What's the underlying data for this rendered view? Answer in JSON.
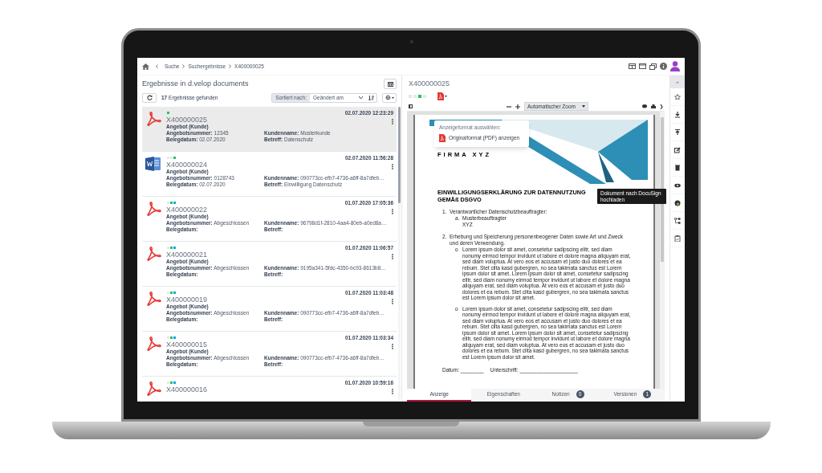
{
  "breadcrumbs": [
    "Suche",
    "Suchergebnisse",
    "X400000025"
  ],
  "results": {
    "title": "Ergebnisse in d.velop documents",
    "count": "17",
    "count_label": "Ergebnisse gefunden",
    "sort_label": "Sortiert nach:",
    "sort_value": "Geändert am",
    "items": [
      {
        "kind": "pdf",
        "selected": true,
        "dots": [
          {
            "color": "#22c55e"
          }
        ],
        "id": "X400000025",
        "date": "02.07.2020 12:23:29",
        "type": "Angebot (Kunde)",
        "fields": [
          {
            "label": "Angebotsnummer:",
            "value": "12345"
          },
          {
            "label": "Kundenname:",
            "value": "Musterkunde"
          },
          {
            "label": "Belegdatum:",
            "value": "02.07.2020"
          },
          {
            "label": "Betreff:",
            "value": "Datenschutz"
          }
        ]
      },
      {
        "kind": "word",
        "selected": false,
        "dots": [
          {
            "color": "#e5e7eb"
          },
          {
            "color": "#e5e7eb"
          },
          {
            "color": "#22c55e"
          }
        ],
        "id": "X400000024",
        "date": "02.07.2020 11:56:28",
        "type": "Angebot (Kunde)",
        "fields": [
          {
            "label": "Angebotsnummer:",
            "value": "0128743"
          },
          {
            "label": "Kundenname:",
            "value": "090773cc-efb7-4736-a6ff-8a7dfeb…"
          },
          {
            "label": "Belegdatum:",
            "value": "02.07.2020"
          },
          {
            "label": "Betreff:",
            "value": "Einwilligung Datenschutz"
          }
        ]
      },
      {
        "kind": "pdf",
        "selected": false,
        "dots": [
          {
            "color": "#e5e7eb"
          },
          {
            "color": "#22c55e"
          },
          {
            "color": "#0ea5e9"
          }
        ],
        "id": "X400000022",
        "date": "01.07.2020 17:05:36",
        "type": "Angebot (Kunde)",
        "fields": [
          {
            "label": "Angebotsnummer:",
            "value": "Abgeschlossen"
          },
          {
            "label": "Kundenname:",
            "value": "96798d1f-2810-4aa4-80eb-a0ed8a…"
          },
          {
            "label": "Belegdatum:"
          },
          {
            "label": "Betreff:"
          }
        ]
      },
      {
        "kind": "pdf",
        "selected": false,
        "dots": [
          {
            "color": "#e5e7eb"
          },
          {
            "color": "#22c55e"
          },
          {
            "color": "#0ea5e9"
          }
        ],
        "id": "X400000021",
        "date": "01.07.2020 11:06:57",
        "type": "Angebot (Kunde)",
        "fields": [
          {
            "label": "Angebotsnummer:",
            "value": "Abgeschlossen"
          },
          {
            "label": "Kundenname:",
            "value": "9195a341-5fdc-4350-bc93-8613b8…"
          },
          {
            "label": "Belegdatum:"
          },
          {
            "label": "Betreff:"
          }
        ]
      },
      {
        "kind": "pdf",
        "selected": false,
        "dots": [
          {
            "color": "#e5e7eb"
          },
          {
            "color": "#22c55e"
          },
          {
            "color": "#0ea5e9"
          }
        ],
        "id": "X400000019",
        "date": "01.07.2020 11:03:48",
        "type": "Angebot (Kunde)",
        "fields": [
          {
            "label": "Angebotsnummer:",
            "value": "Abgeschlossen"
          },
          {
            "label": "Kundenname:",
            "value": "090773cc-efb7-4736-a6ff-8a7dfeb…"
          },
          {
            "label": "Belegdatum:"
          },
          {
            "label": "Betreff:"
          }
        ]
      },
      {
        "kind": "pdf",
        "selected": false,
        "dots": [
          {
            "color": "#e5e7eb"
          },
          {
            "color": "#22c55e"
          },
          {
            "color": "#0ea5e9"
          }
        ],
        "id": "X400000015",
        "date": "01.07.2020 11:03:34",
        "type": "Angebot (Kunde)",
        "fields": [
          {
            "label": "Angebotsnummer:",
            "value": "Abgeschlossen"
          },
          {
            "label": "Kundenname:",
            "value": "090773cc-efb7-4736-a6ff-8a7dfeb…"
          },
          {
            "label": "Belegdatum:"
          },
          {
            "label": "Betreff:"
          }
        ]
      },
      {
        "kind": "pdf",
        "selected": false,
        "dots": [
          {
            "color": "#e5e7eb"
          },
          {
            "color": "#22c55e"
          },
          {
            "color": "#0ea5e9"
          }
        ],
        "id": "X400000016",
        "date": "01.07.2020 10:59:16"
      }
    ]
  },
  "viewer": {
    "title": "X400000025",
    "status": [
      {
        "color": "#e5e7eb"
      },
      {
        "color": "#e5e7eb"
      },
      {
        "color": "#22c55e"
      },
      {
        "color": "#e5e7eb"
      }
    ],
    "zoom": "Automatischer Zoom",
    "format_menu": {
      "heading": "Anzeigeformat auswählen:",
      "option": "Originalformat (PDF) anzeigen"
    },
    "tooltip": "Dokument nach DocuSign hochladen",
    "document": {
      "company": "FIRMA XYZ",
      "heading": "EINWILLIGUNGSERKLÄRUNG ZUR DATENNUTZUNG GEMÄß DSGVO",
      "sections": [
        {
          "marker": "1.",
          "text": "Verantwortlicher Datenschutzbeauftragter:",
          "children": [
            {
              "marker": "a.",
              "text": "Musterbeauftragter",
              "extra": "XYZ"
            }
          ]
        },
        {
          "marker": "2.",
          "text": "Erhebung und Speicherung personenbeogener Daten sowie Art und Zweck und deren Verwendung.",
          "children": [
            {
              "marker": "o",
              "text": "Lorem ipsum dolor sit amet, consetetur sadipscing elitr, sed diam nonumy eirmod tempor invidunt ut labore et dolore magna aliquyam erat, sed diam voluptua. At vero eos et accusam et justo duo dolores et ea rebum. Stet clita kasd gubergren, no sea takimata sanctus est Lorem ipsum dolor sit amet. Lorem ipsum dolor sit amet, consetetur sadipscing elitr, sed diam nonumy eirmod tempor invidunt ut labore et dolore magna aliquyam erat, sed diam voluptua. At vero eos et accusam et justo duo dolores et ea rebum. Stet clita kasd gubergren, no sea takimata sanctus est Lorem ipsum dolor sit amet."
            },
            {
              "marker": "o",
              "text": "Lorem ipsum dolor sit amet, consetetur sadipscing elitr, sed diam nonumy eirmod tempor invidunt ut labore et dolore magna aliquyam erat, sed diam voluptua. At vero eos et accusam et justo duo dolores et ea rebum. Stet clita kasd gubergren, no sea takimata sanctus est Lorem ipsum dolor sit amet. Lorem ipsum dolor sit amet, consetetur sadipscing elitr, sed diam nonumy eirmod tempor invidunt ut labore et dolore magna aliquyam erat, sed diam voluptua. At vero eos et accusam et justo duo dolores et ea rebum. Stet clita kasd gubergren, no sea takimata sanctus est Lorem ipsum dolor sit amet."
            }
          ]
        }
      ],
      "signature": [
        "Datum: ________",
        "Unterschrift: ____________________"
      ]
    },
    "tabs": [
      {
        "label": "Anzeige",
        "selected": true
      },
      {
        "label": "Eigenschaften",
        "selected": false
      },
      {
        "label": "Notizen",
        "selected": false,
        "badge": "0"
      },
      {
        "label": "Versionen",
        "selected": false,
        "badge": "1"
      }
    ]
  },
  "rail": [
    {
      "kind": "collapse",
      "label": "«"
    },
    {
      "kind": "star"
    },
    {
      "kind": "download"
    },
    {
      "kind": "upload"
    },
    {
      "kind": "edit"
    },
    {
      "kind": "trash"
    },
    {
      "kind": "eye"
    },
    {
      "kind": "globe"
    },
    {
      "kind": "workflow"
    },
    {
      "kind": "clipboard"
    }
  ]
}
